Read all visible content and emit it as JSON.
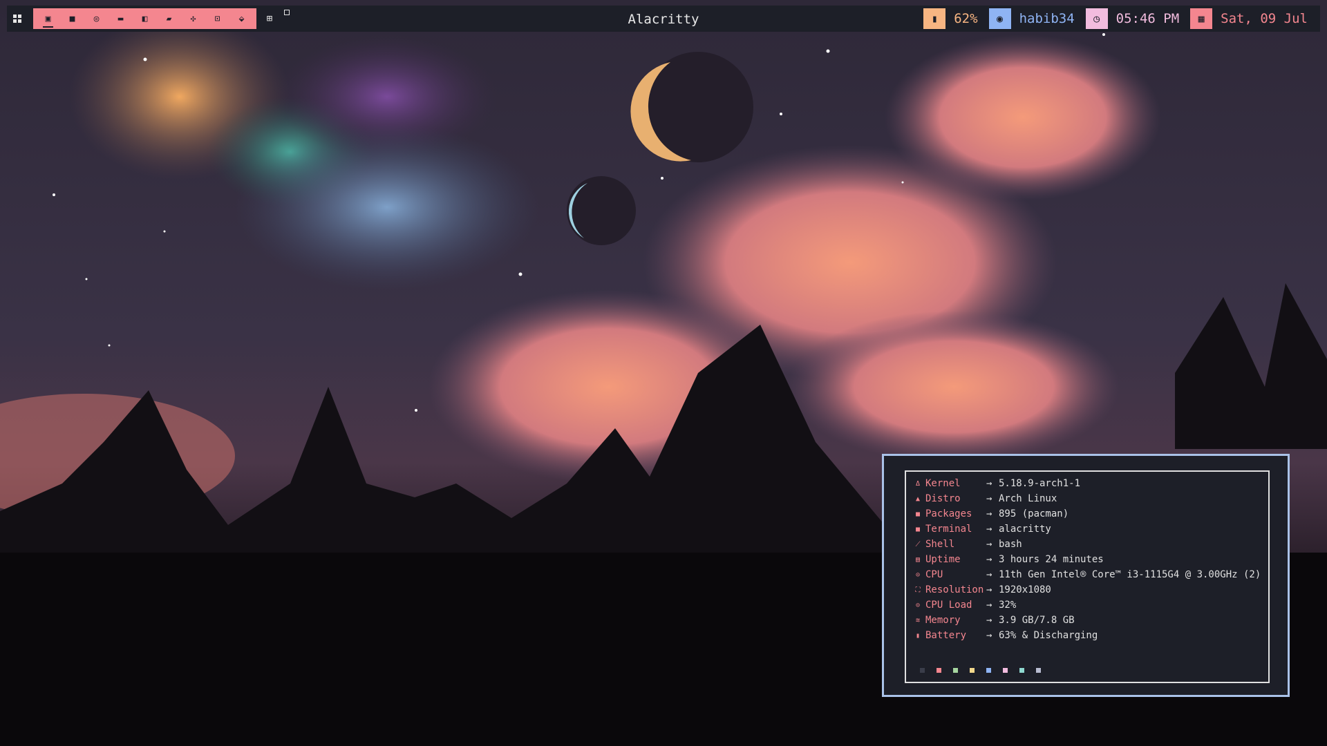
{
  "window_title": "Alacritty",
  "bar": {
    "accent": "#f4868f",
    "background": "#1d1f28",
    "launcher_icon": "grid-icon",
    "workspaces": [
      {
        "icon": "terminal-icon",
        "glyph": "▣",
        "active": true
      },
      {
        "icon": "folder-icon",
        "glyph": "■"
      },
      {
        "icon": "browser-icon",
        "glyph": "◎"
      },
      {
        "icon": "editor-icon",
        "glyph": "▬"
      },
      {
        "icon": "music-icon",
        "glyph": "◧"
      },
      {
        "icon": "chat-icon",
        "glyph": "▰"
      },
      {
        "icon": "game-icon",
        "glyph": "✣"
      },
      {
        "icon": "settings-icon",
        "glyph": "⊡"
      },
      {
        "icon": "misc-icon",
        "glyph": "⬙"
      }
    ],
    "layout_icon": "layout-grid-icon",
    "modules": [
      {
        "name": "battery",
        "icon": "battery-icon",
        "glyph": "▮",
        "color": "#f7b582",
        "text": "62%"
      },
      {
        "name": "network",
        "icon": "wifi-icon",
        "glyph": "◉",
        "color": "#8fb4f4",
        "text": "habib34"
      },
      {
        "name": "clock",
        "icon": "clock-icon",
        "glyph": "◷",
        "color": "#f2bcde",
        "text": "05:46 PM"
      },
      {
        "name": "date",
        "icon": "calendar-icon",
        "glyph": "▦",
        "color": "#f4868f",
        "text": "Sat, 09 Jul"
      }
    ]
  },
  "neofetch": {
    "rows": [
      {
        "icon": "linux-icon",
        "glyph": "Δ",
        "key": "Kernel",
        "value": "5.18.9-arch1-1"
      },
      {
        "icon": "arch-icon",
        "glyph": "▲",
        "key": "Distro",
        "value": "Arch Linux"
      },
      {
        "icon": "package-icon",
        "glyph": "■",
        "key": "Packages",
        "value": "895 (pacman)"
      },
      {
        "icon": "terminal-icon",
        "glyph": "■",
        "key": "Terminal",
        "value": "alacritty"
      },
      {
        "icon": "shell-icon",
        "glyph": "⟋",
        "key": "Shell",
        "value": "bash"
      },
      {
        "icon": "uptime-icon",
        "glyph": "▤",
        "key": "Uptime",
        "value": "3 hours 24 minutes"
      },
      {
        "icon": "cpu-icon",
        "glyph": "⊙",
        "key": "CPU",
        "value": "11th Gen Intel® Core™ i3-1115G4 @ 3.00GHz (2)"
      },
      {
        "icon": "resolution-icon",
        "glyph": "⛶",
        "key": "Resolution",
        "value": "1920x1080"
      },
      {
        "icon": "cpu-load-icon",
        "glyph": "⊙",
        "key": "CPU Load",
        "value": "32%"
      },
      {
        "icon": "memory-icon",
        "glyph": "≋",
        "key": "Memory",
        "value": "3.9 GB/7.8 GB"
      },
      {
        "icon": "battery-icon",
        "glyph": "▮",
        "key": "Battery",
        "value": "63% & Discharging"
      }
    ],
    "arrow": "→",
    "palette": [
      "#3a3d4a",
      "#f4868f",
      "#a6d5a0",
      "#f2d88c",
      "#8fb4f4",
      "#f2bcde",
      "#8fd8cf",
      "#b8bcd0"
    ]
  }
}
